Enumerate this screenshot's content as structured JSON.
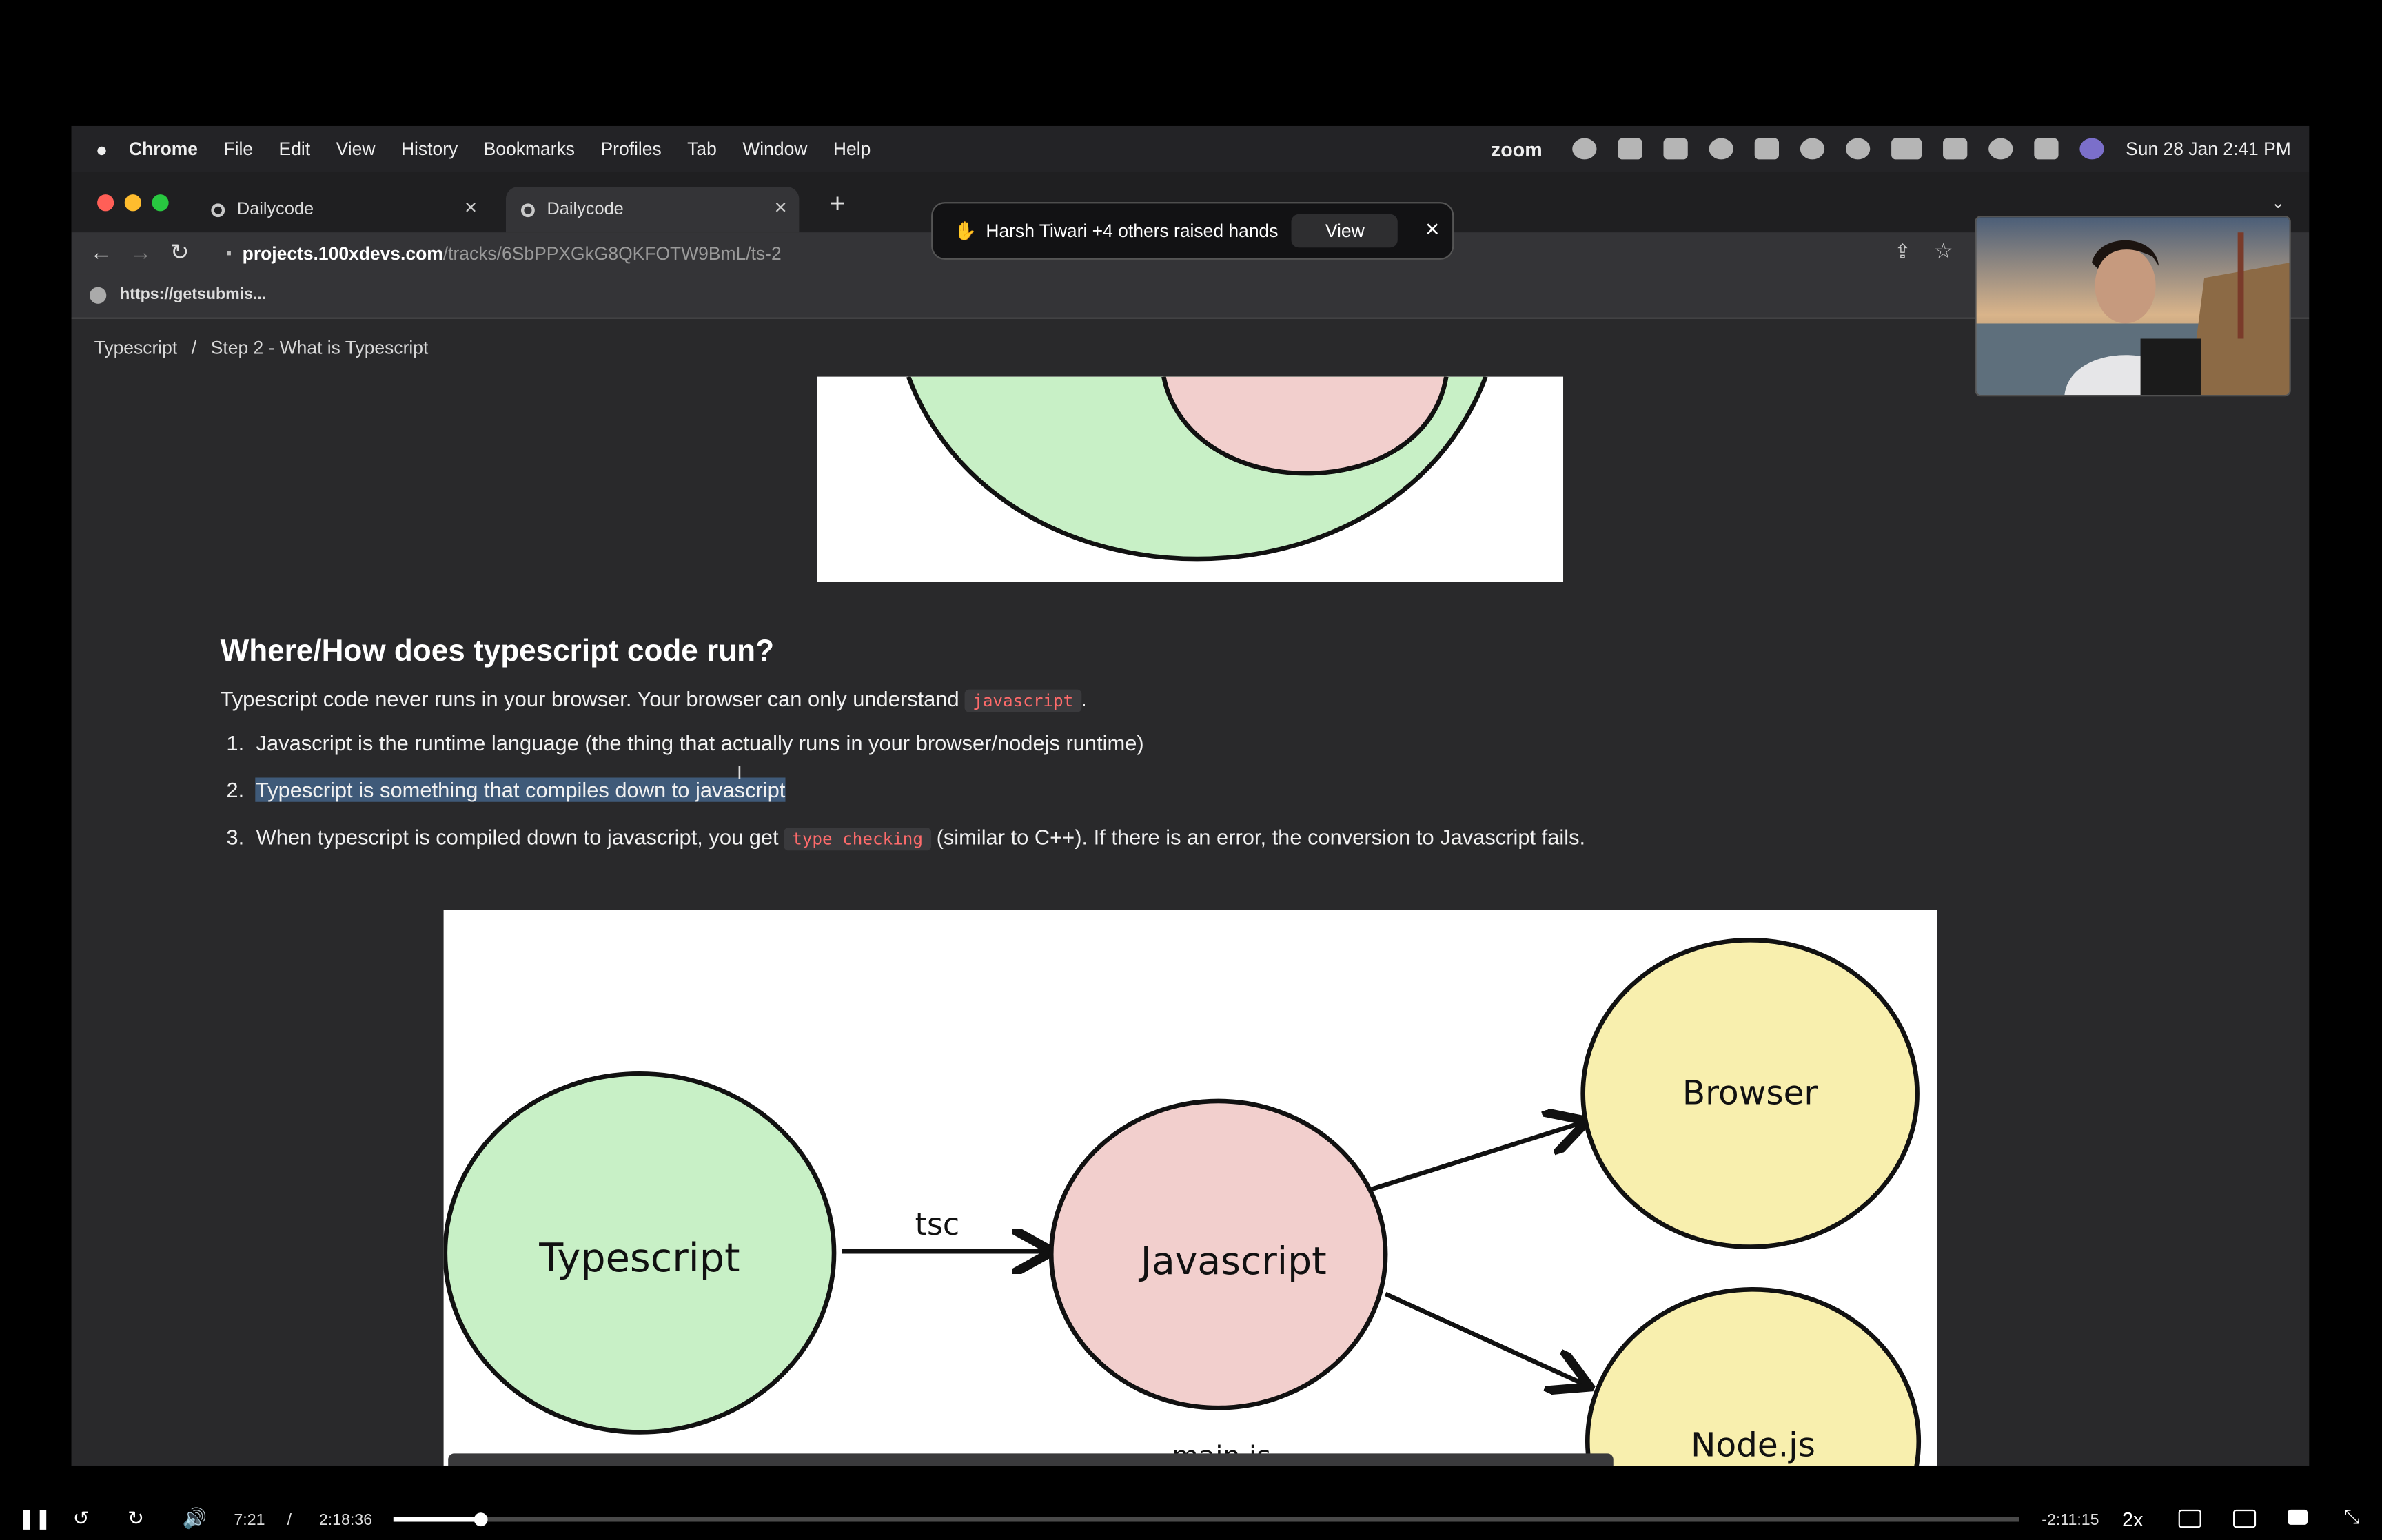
{
  "menubar": {
    "items": [
      "Chrome",
      "File",
      "Edit",
      "View",
      "History",
      "Bookmarks",
      "Profiles",
      "Tab",
      "Window",
      "Help"
    ],
    "zoom_label": "zoom",
    "datetime": "Sun 28 Jan  2:41 PM"
  },
  "tabs": [
    {
      "label": "Dailycode",
      "active": false
    },
    {
      "label": "Dailycode",
      "active": true
    }
  ],
  "address": {
    "host": "projects.100xdevs.com",
    "path": "/tracks/6SbPPXGkG8QKFOTW9BmL/ts-2"
  },
  "bookmark": {
    "label": "https://getsubmis..."
  },
  "notification": {
    "icon": "✋",
    "text": "Harsh Tiwari +4 others raised hands",
    "view_label": "View"
  },
  "breadcrumb": {
    "root": "Typescript",
    "separator": "/",
    "current": "Step 2 - What is Typescript"
  },
  "article": {
    "heading": "Where/How does typescript code run?",
    "intro_pre": "Typescript code never runs in your browser. Your browser can only understand",
    "intro_code": "javascript",
    "intro_post": ".",
    "items": [
      {
        "num": "1.",
        "text": "Javascript is the runtime language (the thing that actually runs in your browser/nodejs runtime)"
      },
      {
        "num": "2.",
        "text": "Typescript is something that compiles down to javascript"
      },
      {
        "num": "3.",
        "pre": "When typescript is compiled down to javascript, you get",
        "code": "type checking",
        "post": "(similar to C++). If there is an error, the conversion to Javascript fails."
      }
    ]
  },
  "diagram": {
    "nodes": [
      {
        "label": "Typescript",
        "color": "#c8f0c6"
      },
      {
        "label": "Javascript",
        "color": "#f2cfcd"
      },
      {
        "label": "Browser",
        "color": "#f8efae"
      },
      {
        "label": "Node.js",
        "color": "#f8efae"
      }
    ],
    "edge_label": "tsc",
    "bottom_label": "main.js"
  },
  "player": {
    "current_time": "7:21",
    "separator": "/",
    "duration": "2:18:36",
    "remaining": "-2:11:15",
    "speed": "2x",
    "progress": 0.053,
    "buffered": 0.058
  }
}
